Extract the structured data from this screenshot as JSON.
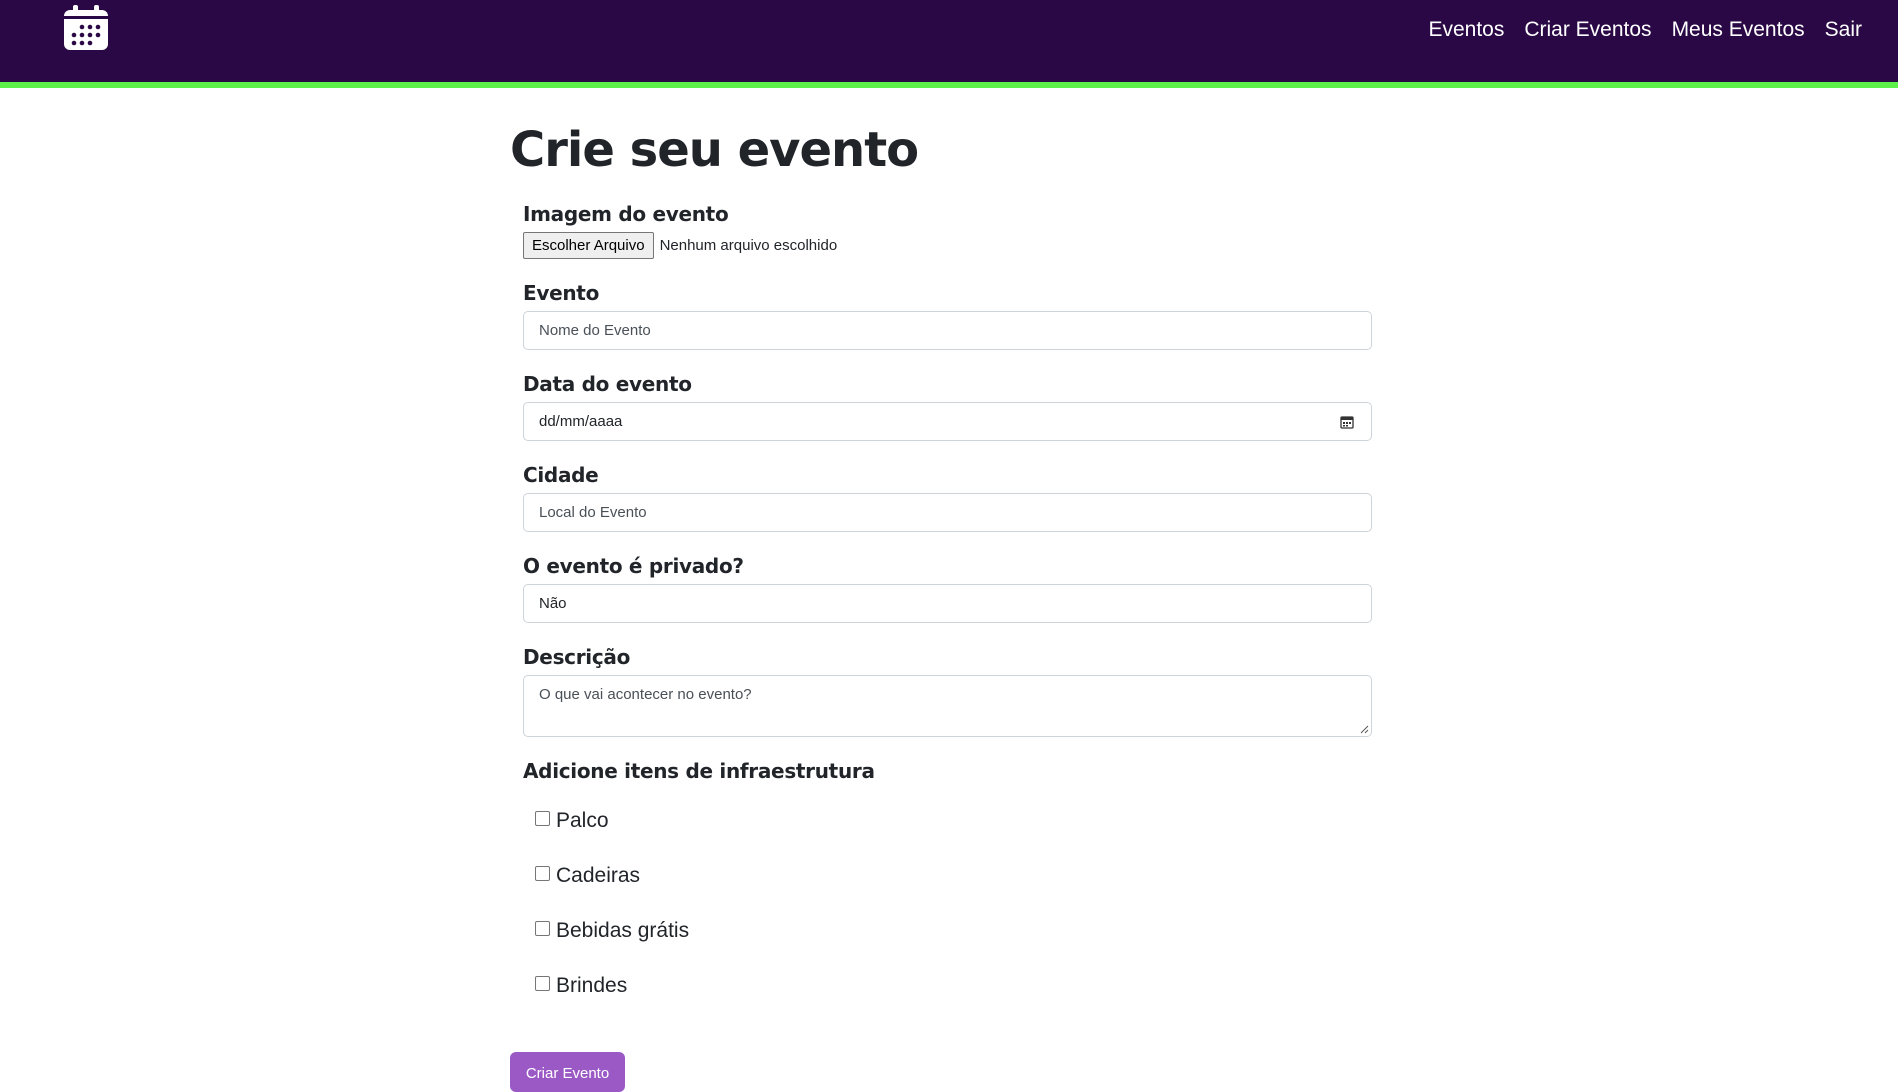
{
  "navbar": {
    "logo_icon": "calendar-icon",
    "links": [
      "Eventos",
      "Criar Eventos",
      "Meus Eventos",
      "Sair"
    ],
    "colors": {
      "background": "#2a0845",
      "accent": "#5df04a"
    }
  },
  "page": {
    "title": "Crie seu evento"
  },
  "form": {
    "image_label": "Imagem do evento",
    "file_button": "Escolher Arquivo",
    "file_status": "Nenhum arquivo escolhido",
    "event_label": "Evento",
    "event_placeholder": "Nome do Evento",
    "date_label": "Data do evento",
    "date_placeholder": "dd/mm/aaaa",
    "city_label": "Cidade",
    "city_placeholder": "Local do Evento",
    "private_label": "O evento é privado?",
    "private_value": "Não",
    "description_label": "Descrição",
    "description_placeholder": "O que vai acontecer no evento?",
    "infra_title": "Adicione itens de infraestrutura",
    "infra_items": [
      "Palco",
      "Cadeiras",
      "Bebidas grátis",
      "Brindes"
    ],
    "submit_label": "Criar Evento",
    "submit_color": "#9b59c5"
  }
}
